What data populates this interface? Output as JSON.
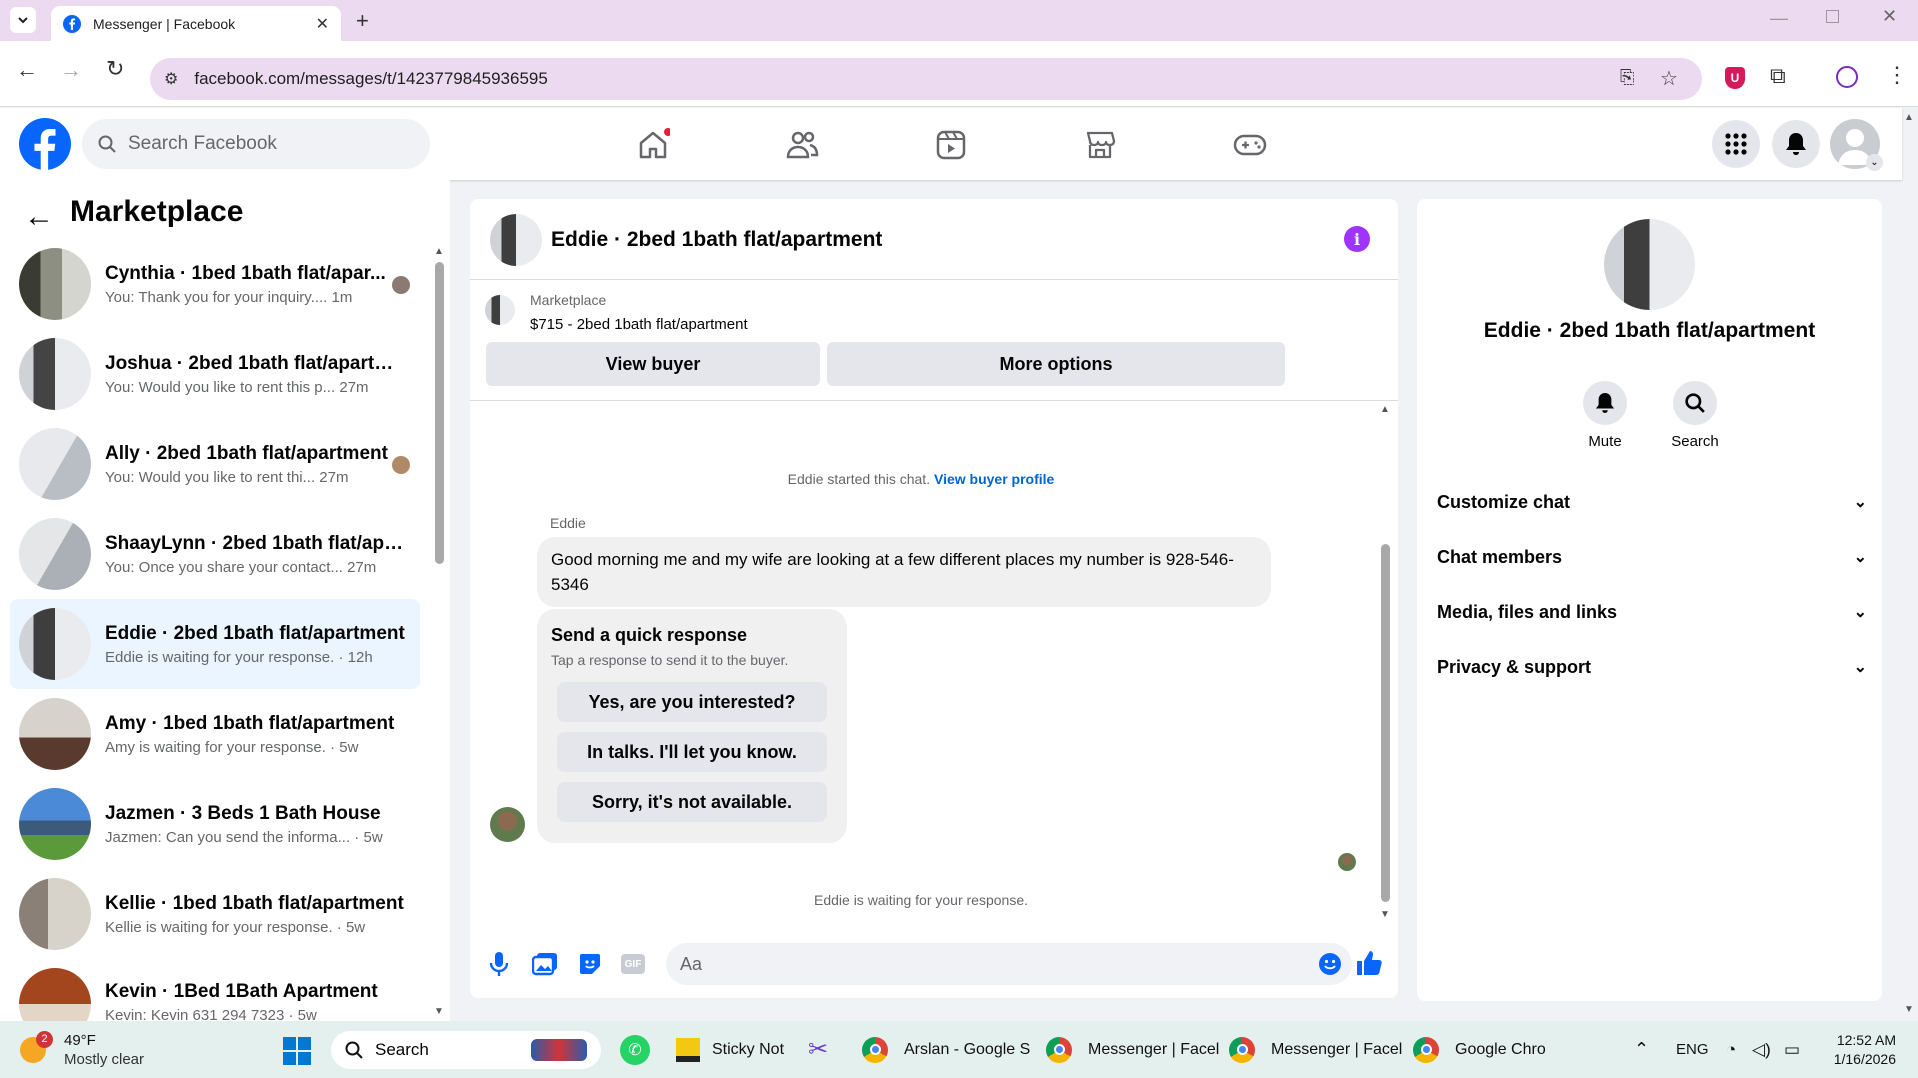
{
  "browser": {
    "tab_title": "Messenger | Facebook",
    "url": "facebook.com/messages/t/1423779845936595"
  },
  "fb_header": {
    "search_placeholder": "Search Facebook"
  },
  "sidebar": {
    "title": "Marketplace",
    "conversations": [
      {
        "name": "Cynthia · 1bed 1bath flat/apar...",
        "preview": "You: Thank you for your inquiry....",
        "time": "1m"
      },
      {
        "name": "Joshua · 2bed 1bath flat/apartm...",
        "preview": "You: Would you like to rent this p...",
        "time": "27m"
      },
      {
        "name": "Ally · 2bed 1bath flat/apartment",
        "preview": "You: Would you like to rent thi...",
        "time": "27m"
      },
      {
        "name": "ShaayLynn · 2bed 1bath flat/apa...",
        "preview": "You: Once you share your contact...",
        "time": "27m"
      },
      {
        "name": "Eddie · 2bed 1bath flat/apartment",
        "preview": "Eddie is waiting for your response.",
        "time": "12h"
      },
      {
        "name": "Amy · 1bed 1bath flat/apartment",
        "preview": "Amy is waiting for your response.",
        "time": "5w"
      },
      {
        "name": "Jazmen · 3 Beds 1 Bath House",
        "preview": "Jazmen: Can you send the informa...",
        "time": "5w"
      },
      {
        "name": "Kellie · 1bed 1bath flat/apartment",
        "preview": "Kellie is waiting for your response.",
        "time": "5w"
      },
      {
        "name": "Kevin · 1Bed 1Bath Apartment",
        "preview": "Kevin: Kevin 631 294 7323",
        "time": "5w"
      }
    ]
  },
  "chat": {
    "title": "Eddie · 2bed 1bath flat/apartment",
    "listing_source": "Marketplace",
    "listing": "$715 - 2bed 1bath flat/apartment",
    "view_buyer": "View buyer",
    "more_options": "More options",
    "started_text": "Eddie started this chat.",
    "view_buyer_profile": "View buyer profile",
    "sender": "Eddie",
    "message": "Good morning me and my wife are looking at a few different places my number is 928-546-5346",
    "quick_title": "Send a quick response",
    "quick_sub": "Tap a response to send it to the buyer.",
    "quick_responses": [
      "Yes, are you interested?",
      "In talks. I'll let you know.",
      "Sorry, it's not available."
    ],
    "waiting": "Eddie is waiting for your response.",
    "composer_placeholder": "Aa",
    "gif_label": "GIF"
  },
  "info_panel": {
    "title": "Eddie · 2bed 1bath flat/apartment",
    "mute": "Mute",
    "search": "Search",
    "sections": [
      "Customize chat",
      "Chat members",
      "Media, files and links",
      "Privacy & support"
    ]
  },
  "taskbar": {
    "weather_temp": "49°F",
    "weather_desc": "Mostly clear",
    "weather_badge": "2",
    "search": "Search",
    "apps": [
      "Sticky Not",
      "Arslan - Google S",
      "Messenger | Facel",
      "Messenger | Facel",
      "Google Chro"
    ],
    "lang": "ENG",
    "time": "12:52 AM",
    "date": "1/16/2026"
  },
  "colors": {
    "fb_blue": "#0866ff",
    "purple_accent": "#a033ff",
    "selected_bg": "#ebf5ff"
  }
}
